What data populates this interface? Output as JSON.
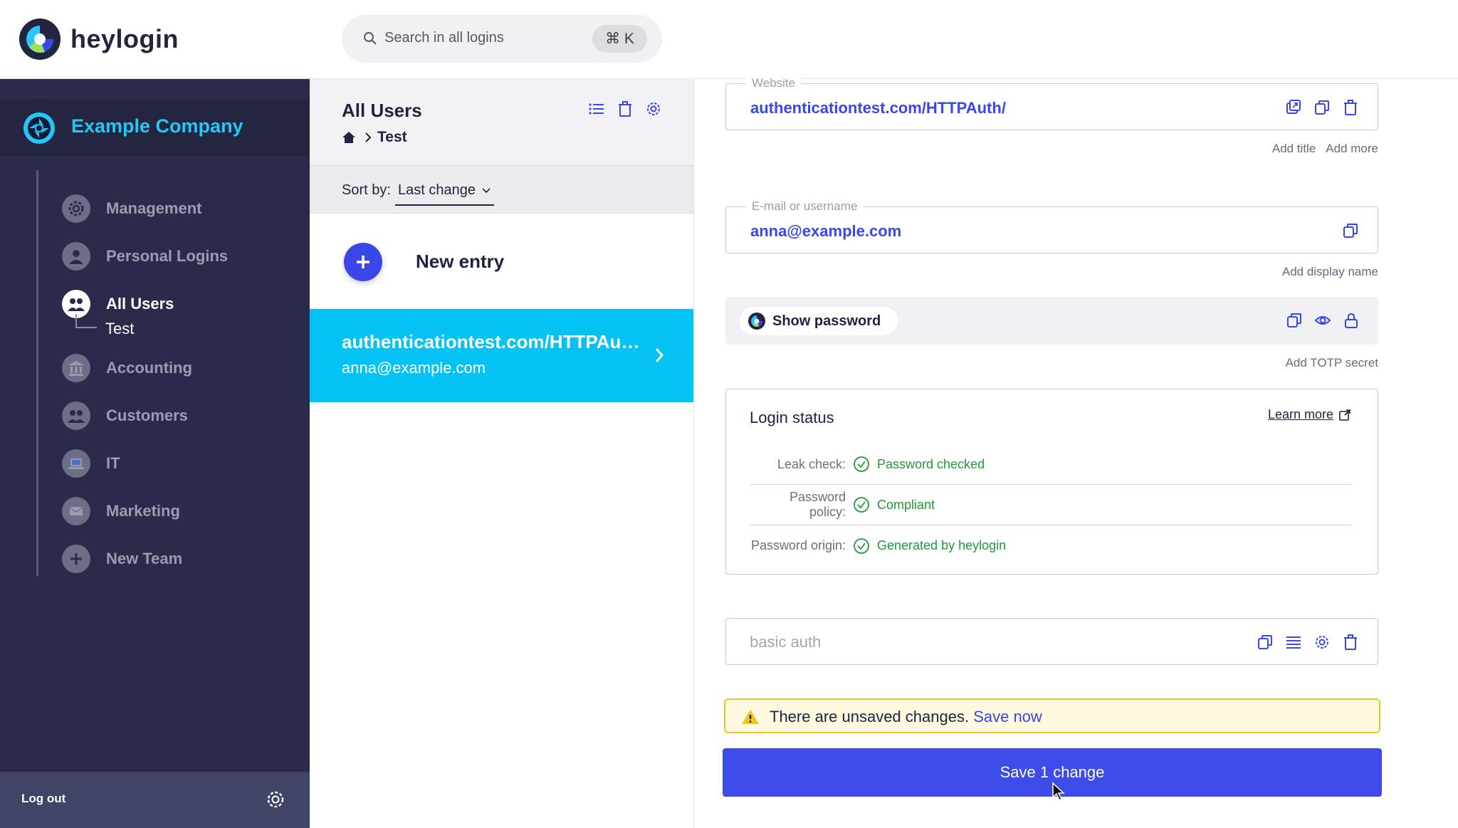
{
  "app": {
    "name": "heylogin",
    "colors": {
      "accent": "#3a47e8",
      "selected": "#04c3f4",
      "sidebar": "#2a2b4a",
      "success": "#1f9a3a",
      "warning": "#f1c325"
    }
  },
  "search": {
    "placeholder": "Search in all logins",
    "shortcut": "⌘ K",
    "icon": "search-icon"
  },
  "sidebar": {
    "company": "Example Company",
    "items": [
      {
        "label": "Management",
        "icon": "gear-icon"
      },
      {
        "label": "Personal Logins",
        "icon": "person-icon"
      },
      {
        "label": "All Users",
        "icon": "group-icon",
        "active": true
      },
      {
        "label": "Accounting",
        "icon": "bank-icon"
      },
      {
        "label": "Customers",
        "icon": "group-icon"
      },
      {
        "label": "IT",
        "icon": "laptop-icon"
      },
      {
        "label": "Marketing",
        "icon": "mail-icon"
      },
      {
        "label": "New Team",
        "icon": "plus-icon"
      }
    ],
    "subitem": "Test",
    "logout": "Log out"
  },
  "list": {
    "title": "All Users",
    "breadcrumb": "Test",
    "sort_label": "Sort by:",
    "sort_value": "Last change",
    "new_entry": "New entry",
    "entries": [
      {
        "title": "authenticationtest.com/HTTPAuth/",
        "subtitle": "anna@example.com"
      }
    ]
  },
  "detail": {
    "website": {
      "label": "Website",
      "value": "authenticationtest.com/HTTPAuth/"
    },
    "website_hints": [
      "Add title",
      "Add more"
    ],
    "username": {
      "label": "E-mail or username",
      "value": "anna@example.com"
    },
    "username_hints": [
      "Add display name"
    ],
    "password": {
      "show_label": "Show password"
    },
    "password_hints": [
      "Add TOTP secret"
    ],
    "login_status": {
      "title": "Login status",
      "learn_more": "Learn more",
      "rows": [
        {
          "key": "Leak check:",
          "value": "Password checked"
        },
        {
          "key": "Password policy:",
          "value": "Compliant"
        },
        {
          "key": "Password origin:",
          "value": "Generated by heylogin"
        }
      ]
    },
    "note": {
      "placeholder": "basic auth"
    },
    "warning": {
      "text": "There are unsaved changes.",
      "link": "Save now"
    },
    "save_button": "Save 1 change"
  }
}
